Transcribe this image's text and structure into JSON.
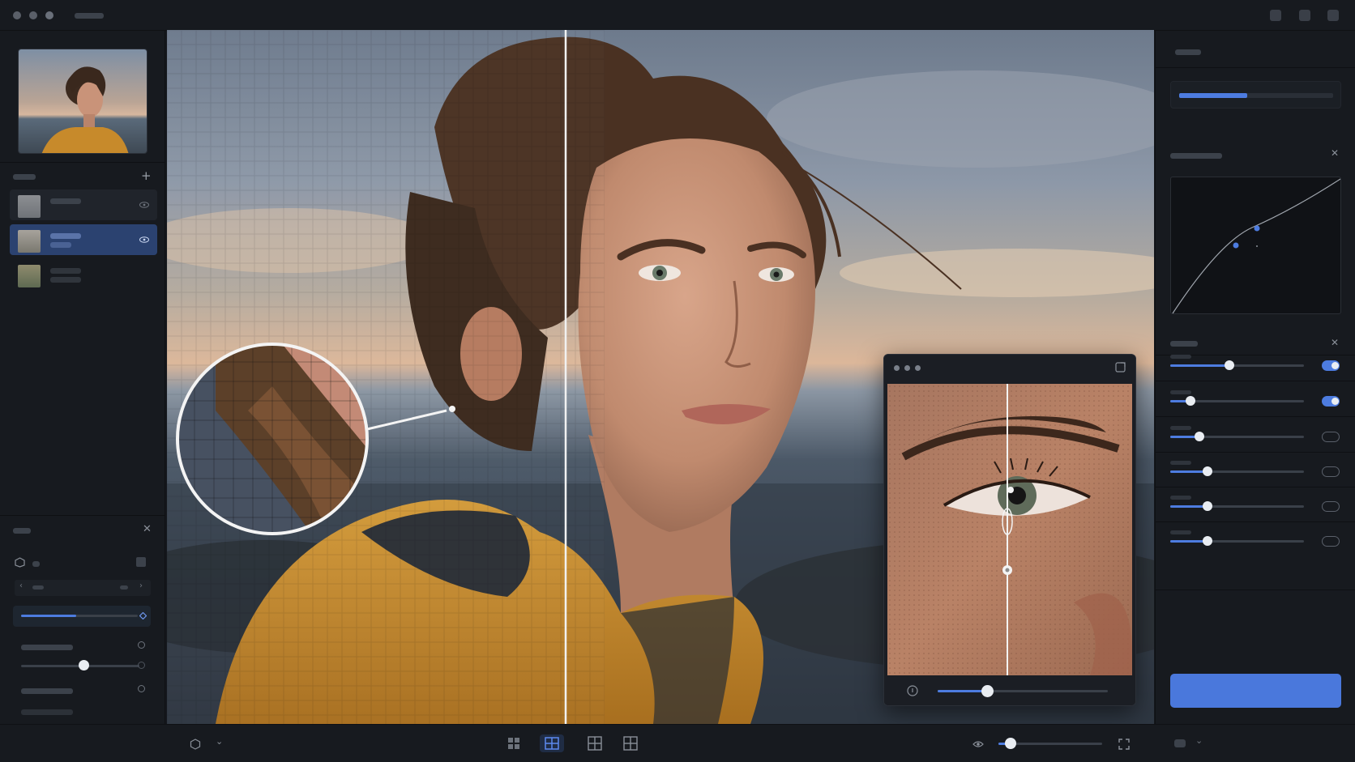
{
  "window": {
    "title": ""
  },
  "left_panel": {
    "layers_header": "",
    "layers": [
      {
        "name": "",
        "active": false,
        "visible": true
      },
      {
        "name": "",
        "active": true,
        "visible": true
      },
      {
        "name": "",
        "active": false,
        "visible": false
      }
    ],
    "adjust_header": "",
    "adjust_sliders": [
      {
        "label": "",
        "value_fraction": 0.47,
        "accent": true
      },
      {
        "label": "",
        "value_fraction": 0.0,
        "accent": false
      },
      {
        "label": "",
        "value_fraction": 0.53,
        "accent": false
      },
      {
        "label": "",
        "value_fraction": 0.0,
        "accent": false
      }
    ]
  },
  "canvas": {
    "split_view": true,
    "left_half": "pixelated",
    "right_half": "enhanced"
  },
  "magnifier_window": {
    "zoom_fraction": 0.29
  },
  "right_panel": {
    "top_header": "",
    "progress_fraction": 0.44,
    "curves_header": "",
    "settings_header": "",
    "settings_rows": [
      {
        "label": "",
        "value_fraction": 0.44,
        "enabled": true
      },
      {
        "label": "",
        "value_fraction": 0.15,
        "enabled": true
      },
      {
        "label": "",
        "value_fraction": 0.22,
        "enabled": false
      },
      {
        "label": "",
        "value_fraction": 0.28,
        "enabled": false
      },
      {
        "label": "",
        "value_fraction": 0.28,
        "enabled": false
      },
      {
        "label": "",
        "value_fraction": 0.28,
        "enabled": false
      }
    ],
    "primary_button_label": ""
  },
  "bottom_toolbar": {
    "view_modes": [
      "grid-view-icon",
      "split-view-icon",
      "quad-view-icon",
      "compare-view-icon"
    ],
    "active_view": 1,
    "zoom_fraction": 0.12
  },
  "colors": {
    "accent": "#4d7ce0",
    "panel_bg": "#171a1f",
    "app_bg": "#14171c",
    "active_layer": "#2b4270",
    "jacket": "#c88a2a"
  }
}
